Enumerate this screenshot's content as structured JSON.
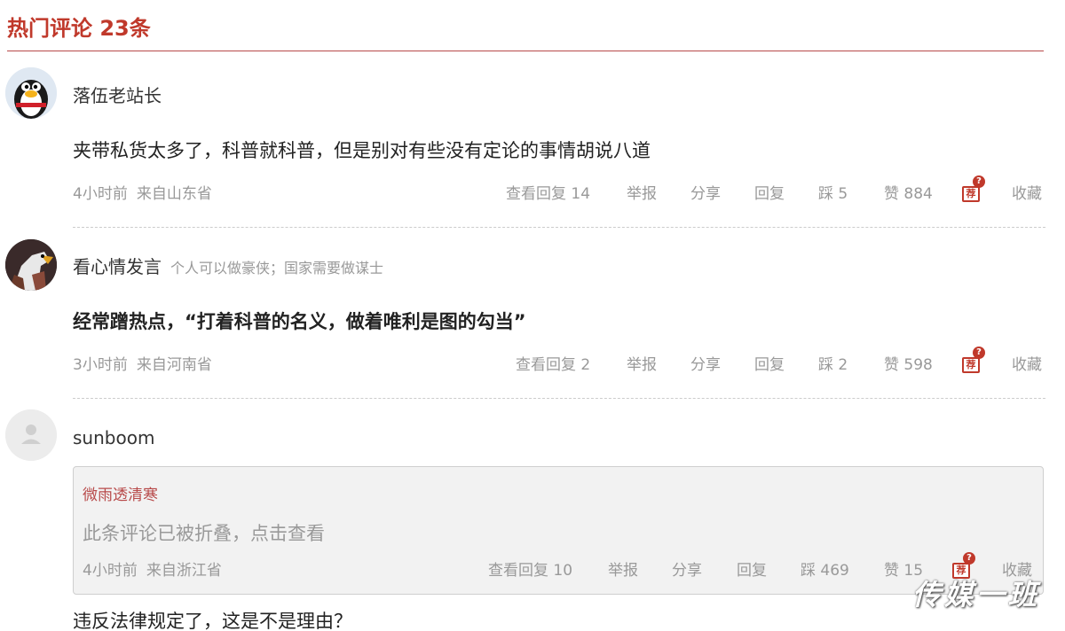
{
  "header": {
    "title": "热门评论 23条"
  },
  "comments": [
    {
      "username": "落伍老站长",
      "signature": "",
      "content": "夹带私货太多了，科普就科普，但是别对有些没有定论的事情胡说八道",
      "time": "4小时前",
      "location": "来自山东省",
      "view_replies": "查看回复 14",
      "report": "举报",
      "share": "分享",
      "reply": "回复",
      "dislike": "踩 5",
      "like": "赞 884",
      "recommend_label": "荐",
      "collect": "收藏"
    },
    {
      "username": "看心情发言",
      "signature": "个人可以做豪侠；国家需要做谋士",
      "content": "经常蹭热点，“打着科普的名义，做着唯利是图的勾当”",
      "time": "3小时前",
      "location": "来自河南省",
      "view_replies": "查看回复 2",
      "report": "举报",
      "share": "分享",
      "reply": "回复",
      "dislike": "踩 2",
      "like": "赞 598",
      "recommend_label": "荐",
      "collect": "收藏"
    },
    {
      "username": "sunboom",
      "folded": {
        "username": "微雨透清寒",
        "message": "此条评论已被折叠，点击查看",
        "time": "4小时前",
        "location": "来自浙江省",
        "view_replies": "查看回复 10",
        "report": "举报",
        "share": "分享",
        "reply": "回复",
        "dislike": "踩 469",
        "like": "赞 15",
        "recommend_label": "荐",
        "collect": "收藏"
      },
      "content": "违反法律规定了，这是不是理由？"
    }
  ],
  "recommend_badge": "?",
  "watermark": "传媒一班",
  "colors": {
    "accent": "#c0392b",
    "muted": "#999999"
  }
}
